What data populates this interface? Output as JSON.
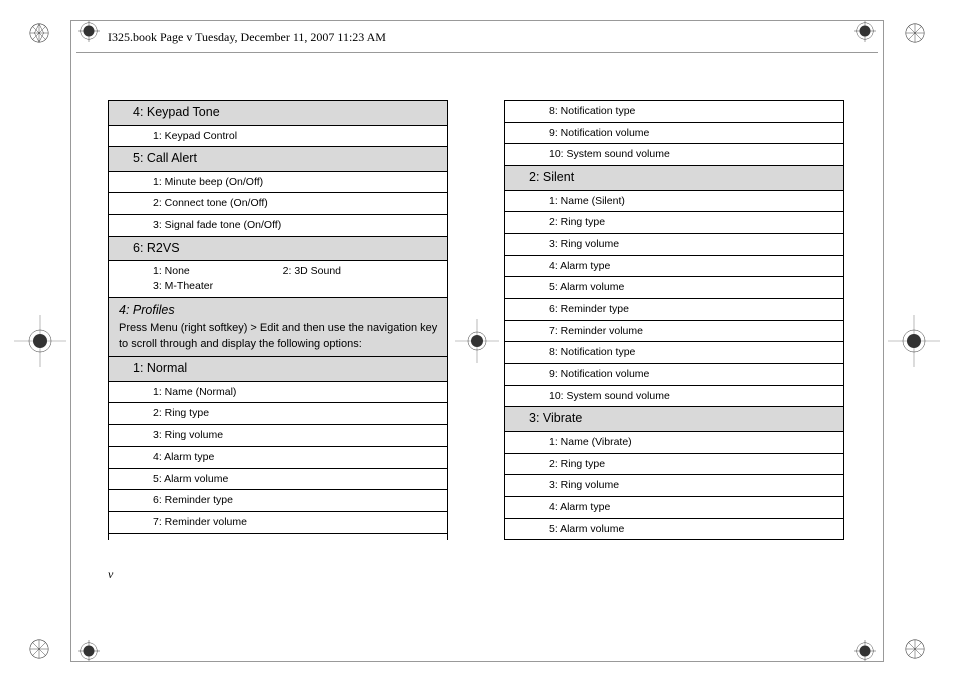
{
  "header": "I325.book  Page v  Tuesday, December 11, 2007  11:23 AM",
  "page_number": "v",
  "left_col": {
    "s4": {
      "title": "4: Keypad Tone",
      "items": [
        "1: Keypad Control"
      ]
    },
    "s5": {
      "title": "5: Call Alert",
      "items": [
        "1: Minute beep (On/Off)",
        "2: Connect tone (On/Off)",
        "3: Signal fade tone (On/Off)"
      ]
    },
    "s6": {
      "title": "6: R2VS",
      "pairs": [
        "1: None",
        "2: 3D Sound",
        "3: M-Theater"
      ]
    },
    "profiles": {
      "title": "4: Profiles",
      "desc": "Press Menu (right softkey) > Edit and then use the navigation key to scroll through and display the following options:"
    },
    "normal": {
      "title": "1: Normal",
      "items": [
        "1: Name (Normal)",
        "2: Ring type",
        "3: Ring volume",
        "4: Alarm type",
        "5: Alarm volume",
        "6: Reminder type",
        "7: Reminder volume"
      ]
    }
  },
  "right_col": {
    "cont": [
      "8: Notification type",
      "9: Notification volume",
      "10: System sound volume"
    ],
    "silent": {
      "title": "2: Silent",
      "items": [
        "1: Name (Silent)",
        "2: Ring type",
        "3: Ring volume",
        "4: Alarm type",
        "5: Alarm volume",
        "6: Reminder type",
        "7: Reminder volume",
        "8: Notification type",
        "9: Notification volume",
        "10: System sound volume"
      ]
    },
    "vibrate": {
      "title": "3: Vibrate",
      "items": [
        "1: Name (Vibrate)",
        "2: Ring type",
        "3: Ring volume",
        "4: Alarm type",
        "5: Alarm volume"
      ]
    }
  }
}
